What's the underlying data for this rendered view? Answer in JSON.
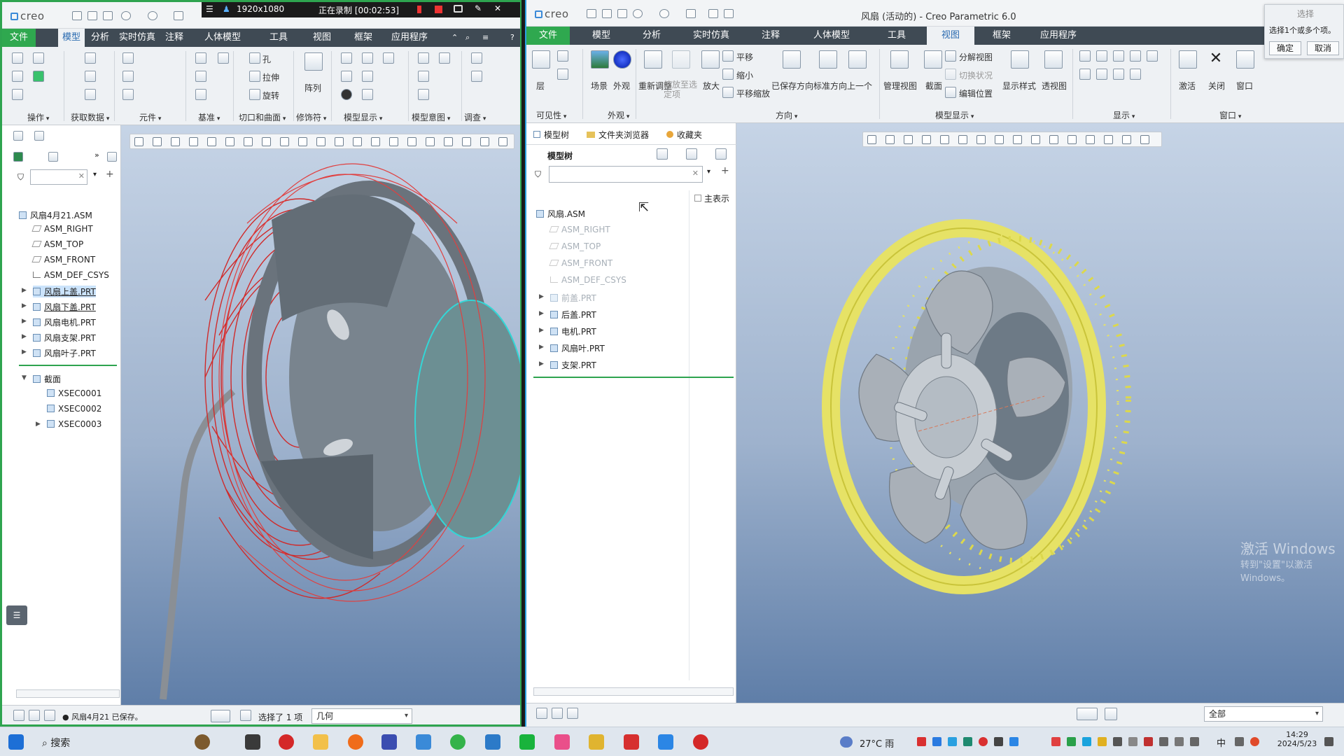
{
  "recorder": {
    "resolution": "1920x1080",
    "status": "正在录制 [00:02:53]"
  },
  "left": {
    "logo": "creo",
    "tabs": [
      "文件",
      "模型",
      "分析",
      "实时仿真",
      "注释",
      "人体模型",
      "工具",
      "视图",
      "框架",
      "应用程序"
    ],
    "groups": [
      "操作",
      "获取数据",
      "元件",
      "基准",
      "切口和曲面",
      "修饰符",
      "模型显示",
      "模型意图",
      "调查"
    ],
    "ribbon_labels": [
      "孔",
      "拉伸",
      "旋转",
      "阵列"
    ],
    "tree": {
      "items": [
        "风扇4月21.ASM",
        "ASM_RIGHT",
        "ASM_TOP",
        "ASM_FRONT",
        "ASM_DEF_CSYS",
        "风扇上盖.PRT",
        "风扇下盖.PRT",
        "风扇电机.PRT",
        "风扇支架.PRT",
        "风扇叶子.PRT",
        "截面",
        "XSEC0001",
        "XSEC0002",
        "XSEC0003"
      ]
    },
    "status": {
      "message": "● 风扇4月21 已保存。",
      "selected": "选择了 1 项",
      "filter": "几何"
    }
  },
  "right": {
    "logo": "creo",
    "title": "风扇 (活动的) - Creo Parametric 6.0",
    "tabs": [
      "文件",
      "模型",
      "分析",
      "实时仿真",
      "注释",
      "人体模型",
      "工具",
      "视图",
      "框架",
      "应用程序"
    ],
    "ribbon": {
      "items": [
        "层",
        "场景",
        "外观",
        "重新调整",
        "缩放至选定项",
        "放大",
        "平移",
        "缩小",
        "平移缩放",
        "已保存方向",
        "标准方向",
        "上一个",
        "管理视图",
        "截面",
        "分解视图",
        "切换状况",
        "编辑位置",
        "显示样式",
        "透视图",
        "激活",
        "关闭",
        "窗口"
      ],
      "groups": [
        "可见性",
        "外观",
        "方向",
        "模型显示",
        "显示",
        "窗口"
      ]
    },
    "pane_tabs": [
      "模型树",
      "文件夹浏览器",
      "收藏夹"
    ],
    "tree": {
      "header": "模型树",
      "main_rep": "主表示",
      "items": [
        "风扇.ASM",
        "ASM_RIGHT",
        "ASM_TOP",
        "ASM_FRONT",
        "ASM_DEF_CSYS",
        "前盖.PRT",
        "后盖.PRT",
        "电机.PRT",
        "风扇叶.PRT",
        "支架.PRT"
      ]
    },
    "status": {
      "filter": "全部"
    }
  },
  "dialog": {
    "title": "选择",
    "message": "选择1个或多个项。",
    "ok": "确定",
    "cancel": "取消"
  },
  "watermark": {
    "line1": "激活 Windows",
    "line2": "转到\"设置\"以激活 Windows。"
  },
  "taskbar": {
    "search": "搜索",
    "weather": "27°C 雨",
    "ime": "中",
    "time": "14:29",
    "date": "2024/5/23"
  }
}
